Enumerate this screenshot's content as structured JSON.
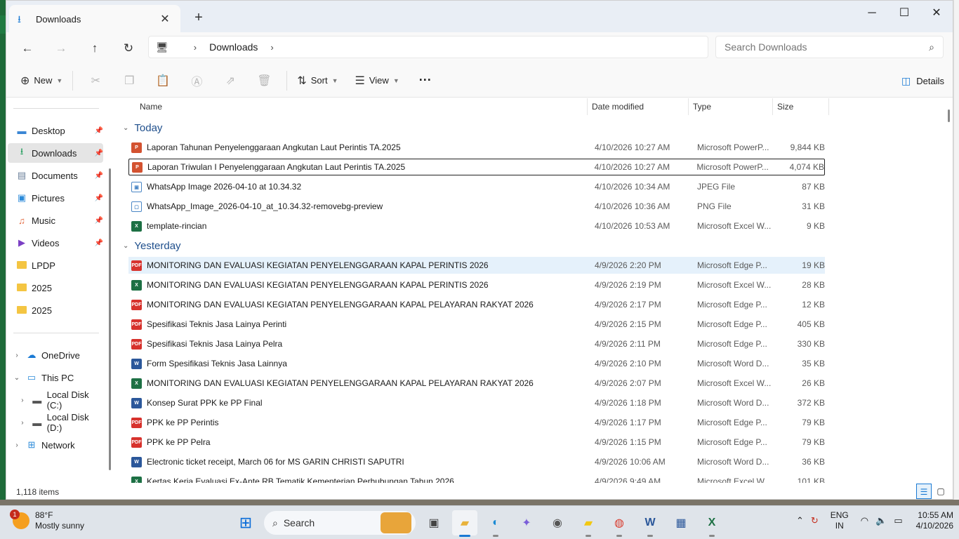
{
  "window": {
    "tab_title": "Downloads",
    "new_tab": "+",
    "minimize": "─",
    "maximize": "☐",
    "close": "✕"
  },
  "nav": {
    "back": "←",
    "forward": "→",
    "up": "↑",
    "refresh": "↻",
    "breadcrumb": [
      "Downloads"
    ],
    "search_placeholder": "Search Downloads"
  },
  "toolbar": {
    "new_label": "New",
    "sort_label": "Sort",
    "view_label": "View",
    "more_label": "···",
    "details_label": "Details"
  },
  "sidebar": {
    "quick_access": [
      {
        "label": "Desktop",
        "icon": "desktop-icon",
        "pinned": true
      },
      {
        "label": "Downloads",
        "icon": "download-icon",
        "pinned": true,
        "active": true
      },
      {
        "label": "Documents",
        "icon": "documents-icon",
        "pinned": true
      },
      {
        "label": "Pictures",
        "icon": "pictures-icon",
        "pinned": true
      },
      {
        "label": "Music",
        "icon": "music-icon",
        "pinned": true
      },
      {
        "label": "Videos",
        "icon": "videos-icon",
        "pinned": true
      },
      {
        "label": "LPDP",
        "icon": "folder-icon",
        "pinned": false
      },
      {
        "label": "2025",
        "icon": "folder-icon",
        "pinned": false
      },
      {
        "label": "2025",
        "icon": "folder-icon",
        "pinned": false
      }
    ],
    "tree": [
      {
        "label": "OneDrive",
        "icon": "cloud-icon",
        "expanded": false,
        "indent": 0
      },
      {
        "label": "This PC",
        "icon": "pc-icon",
        "expanded": true,
        "indent": 0
      },
      {
        "label": "Local Disk (C:)",
        "icon": "drive-icon",
        "expanded": false,
        "indent": 1
      },
      {
        "label": "Local Disk (D:)",
        "icon": "drive-icon",
        "expanded": false,
        "indent": 1
      },
      {
        "label": "Network",
        "icon": "network-icon",
        "expanded": false,
        "indent": 0
      }
    ]
  },
  "columns": {
    "name": "Name",
    "date": "Date modified",
    "type": "Type",
    "size": "Size"
  },
  "groups": [
    {
      "label": "Today",
      "files": [
        {
          "name": "Laporan Tahunan Penyelenggaraan Angkutan Laut Perintis TA.2025",
          "date": "4/10/2026 10:27 AM",
          "type": "Microsoft PowerP...",
          "size": "9,844 KB",
          "kind": "ppt",
          "badge": "P"
        },
        {
          "name": "Laporan Triwulan I Penyelenggaraan Angkutan Laut Perintis TA.2025",
          "date": "4/10/2026 10:27 AM",
          "type": "Microsoft PowerP...",
          "size": "4,074 KB",
          "kind": "ppt",
          "badge": "P",
          "focused": true
        },
        {
          "name": "WhatsApp Image 2026-04-10 at 10.34.32",
          "date": "4/10/2026 10:34 AM",
          "type": "JPEG File",
          "size": "87 KB",
          "kind": "img",
          "badge": "▣"
        },
        {
          "name": "WhatsApp_Image_2026-04-10_at_10.34.32-removebg-preview",
          "date": "4/10/2026 10:36 AM",
          "type": "PNG File",
          "size": "31 KB",
          "kind": "img",
          "badge": "▢"
        },
        {
          "name": "template-rincian",
          "date": "4/10/2026 10:53 AM",
          "type": "Microsoft Excel W...",
          "size": "9 KB",
          "kind": "xls",
          "badge": "X"
        }
      ]
    },
    {
      "label": "Yesterday",
      "files": [
        {
          "name": "MONITORING DAN EVALUASI KEGIATAN PENYELENGGARAAN KAPAL PERINTIS 2026",
          "date": "4/9/2026 2:20 PM",
          "type": "Microsoft Edge P...",
          "size": "19 KB",
          "kind": "pdf",
          "badge": "PDF",
          "hover": true
        },
        {
          "name": "MONITORING DAN EVALUASI KEGIATAN PENYELENGGARAAN KAPAL PERINTIS 2026",
          "date": "4/9/2026 2:19 PM",
          "type": "Microsoft Excel W...",
          "size": "28 KB",
          "kind": "xls",
          "badge": "X"
        },
        {
          "name": "MONITORING DAN EVALUASI KEGIATAN PENYELENGGARAAN KAPAL PELAYARAN RAKYAT 2026",
          "date": "4/9/2026 2:17 PM",
          "type": "Microsoft Edge P...",
          "size": "12 KB",
          "kind": "pdf",
          "badge": "PDF"
        },
        {
          "name": "Spesifikasi Teknis Jasa Lainya Perinti",
          "date": "4/9/2026 2:15 PM",
          "type": "Microsoft Edge P...",
          "size": "405 KB",
          "kind": "pdf",
          "badge": "PDF"
        },
        {
          "name": "Spesifikasi Teknis Jasa Lainya Pelra",
          "date": "4/9/2026 2:11 PM",
          "type": "Microsoft Edge P...",
          "size": "330 KB",
          "kind": "pdf",
          "badge": "PDF"
        },
        {
          "name": "Form Spesifikasi Teknis Jasa Lainnya",
          "date": "4/9/2026 2:10 PM",
          "type": "Microsoft Word D...",
          "size": "35 KB",
          "kind": "doc",
          "badge": "W"
        },
        {
          "name": "MONITORING DAN EVALUASI KEGIATAN PENYELENGGARAAN KAPAL PELAYARAN RAKYAT 2026",
          "date": "4/9/2026 2:07 PM",
          "type": "Microsoft Excel W...",
          "size": "26 KB",
          "kind": "xls",
          "badge": "X"
        },
        {
          "name": "Konsep Surat PPK ke PP Final",
          "date": "4/9/2026 1:18 PM",
          "type": "Microsoft Word D...",
          "size": "372 KB",
          "kind": "doc",
          "badge": "W"
        },
        {
          "name": "PPK ke PP Perintis",
          "date": "4/9/2026 1:17 PM",
          "type": "Microsoft Edge P...",
          "size": "79 KB",
          "kind": "pdf",
          "badge": "PDF"
        },
        {
          "name": "PPK ke PP Pelra",
          "date": "4/9/2026 1:15 PM",
          "type": "Microsoft Edge P...",
          "size": "79 KB",
          "kind": "pdf",
          "badge": "PDF"
        },
        {
          "name": "Electronic ticket receipt, March 06 for MS GARIN CHRISTI SAPUTRI",
          "date": "4/9/2026 10:06 AM",
          "type": "Microsoft Word D...",
          "size": "36 KB",
          "kind": "doc",
          "badge": "W"
        },
        {
          "name": "Kertas Kerja Evaluasi Ex-Ante RB Tematik Kementerian Perhubungan Tahun 2026",
          "date": "4/9/2026 9:49 AM",
          "type": "Microsoft Excel W...",
          "size": "101 KB",
          "kind": "xls",
          "badge": "X"
        }
      ]
    }
  ],
  "status": {
    "item_count": "1,118 items"
  },
  "taskbar": {
    "weather_temp": "88°F",
    "weather_desc": "Mostly sunny",
    "weather_badge": "1",
    "search_label": "Search",
    "lang_top": "ENG",
    "lang_bottom": "IN",
    "time": "10:55 AM",
    "date": "4/10/2026"
  }
}
